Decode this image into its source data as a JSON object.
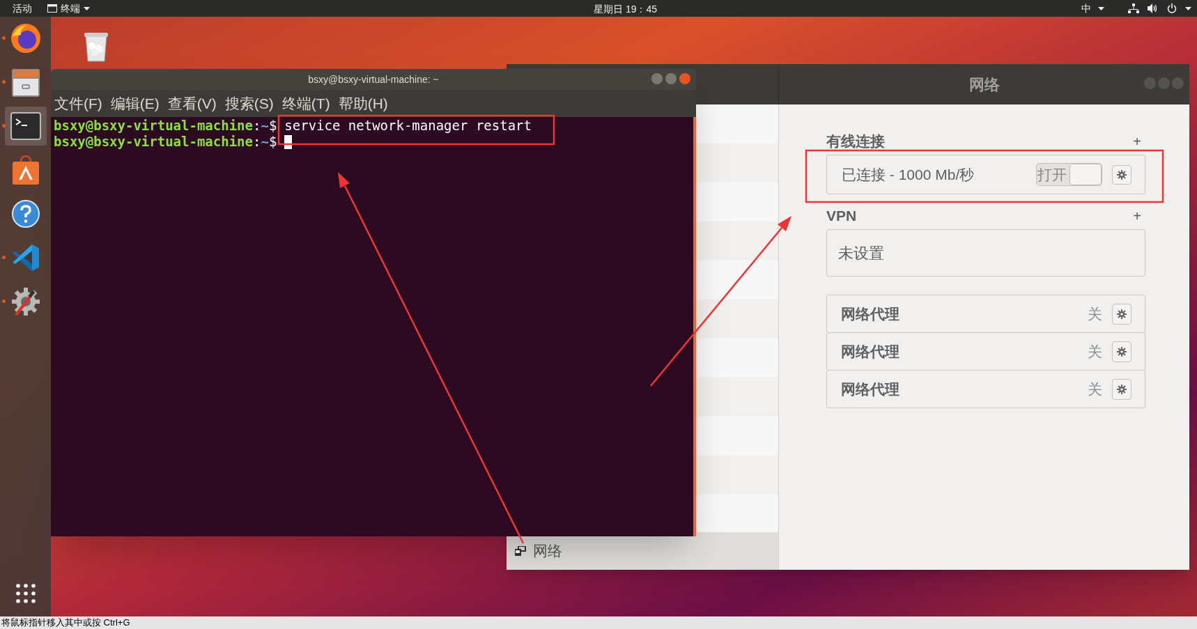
{
  "top_bar": {
    "activities": "活动",
    "app_menu": "终端",
    "clock": "星期日 19：45",
    "input_method": "中"
  },
  "dock": {
    "items": [
      {
        "kind": "browser",
        "running": true,
        "selected": false
      },
      {
        "kind": "files",
        "running": true,
        "selected": false
      },
      {
        "kind": "terminal",
        "running": true,
        "selected": true
      },
      {
        "kind": "software",
        "running": false,
        "selected": false
      },
      {
        "kind": "help",
        "running": false,
        "selected": false
      },
      {
        "kind": "editor",
        "running": true,
        "selected": false
      },
      {
        "kind": "tools",
        "running": true,
        "selected": false
      }
    ]
  },
  "terminal": {
    "title": "bsxy@bsxy-virtual-machine: ~",
    "menu": [
      "文件(F)",
      "编辑(E)",
      "查看(V)",
      "搜索(S)",
      "终端(T)",
      "帮助(H)"
    ],
    "lines": [
      {
        "user": "bsxy@bsxy-virtual-machine",
        "sep": ":",
        "path": "~",
        "sigil": "$",
        "command": "service network-manager restart",
        "cursor": false
      },
      {
        "user": "bsxy@bsxy-virtual-machine",
        "sep": ":",
        "path": "~",
        "sigil": "$",
        "cursor": true
      }
    ]
  },
  "network": {
    "title": "网络",
    "sidebar_item": "网络",
    "sections": [
      {
        "heading": "有线连接",
        "add": "+",
        "rows": [
          {
            "kind": "connection",
            "label": "已连接 - 1000 Mb/秒",
            "switch_label": "打开",
            "on": true
          }
        ]
      },
      {
        "heading": "VPN",
        "add": "+",
        "rows": [
          {
            "kind": "empty",
            "label": "未设置"
          }
        ]
      },
      {
        "rows": [
          {
            "kind": "proxy",
            "label": "网络代理",
            "value": "关"
          },
          {
            "kind": "proxy",
            "label": "网络代理",
            "value": "关"
          },
          {
            "kind": "proxy",
            "label": "网络代理",
            "value": "关"
          }
        ]
      }
    ]
  },
  "status_bar": {
    "text": "将鼠标指针移入其中或按 Ctrl+G"
  }
}
